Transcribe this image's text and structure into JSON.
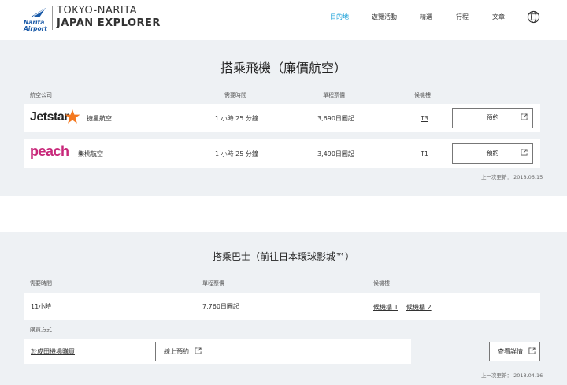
{
  "header": {
    "logo_line1": "Narita",
    "logo_line2": "Airport",
    "brand_line1": "TOKYO-NARITA",
    "brand_line2": "JAPAN EXPLORER",
    "nav": [
      {
        "label": "目的地",
        "active": true
      },
      {
        "label": "遊覽活動",
        "active": false
      },
      {
        "label": "精選",
        "active": false
      },
      {
        "label": "行程",
        "active": false
      },
      {
        "label": "文章",
        "active": false
      }
    ],
    "globe_icon": "globe-icon"
  },
  "flights": {
    "title": "搭乘飛機（廉價航空）",
    "columns": {
      "airline": "航空公司",
      "duration": "需要時間",
      "fare": "單程票價",
      "terminal": "候機樓"
    },
    "rows": [
      {
        "logo": "Jetstar",
        "name": "捷星航空",
        "duration": "1 小時 25 分鐘",
        "fare": "3,690日圓起",
        "terminal": "T3",
        "button": "預約",
        "logo_color": "#222222",
        "star_color": "#f47920"
      },
      {
        "logo": "peach",
        "name": "樂桃航空",
        "duration": "1 小時 25 分鐘",
        "fare": "3,490日圓起",
        "terminal": "T1",
        "button": "預約",
        "logo_color": "#c8287a"
      }
    ],
    "updated": "上一次更新：  2018.06.15"
  },
  "bus": {
    "title": "搭乘巴士（前往日本環球影城™）",
    "columns": {
      "duration": "需要時間",
      "fare": "單程票價",
      "terminal": "候機樓"
    },
    "duration": "11小時",
    "fare": "7,760日圓起",
    "terminal_links": [
      "候機樓 1",
      "候機樓 2"
    ],
    "purchase_label": "購買方式",
    "purchase_link": "於成田機場購買",
    "online_button": "線上預約",
    "details_button": "查看詳情",
    "updated": "上一次更新：  2018.04.16"
  },
  "colors": {
    "accent": "#1aa0d8",
    "section_bg": "#eef1f4",
    "peach": "#c8287a",
    "jetstar_star": "#f47920"
  }
}
